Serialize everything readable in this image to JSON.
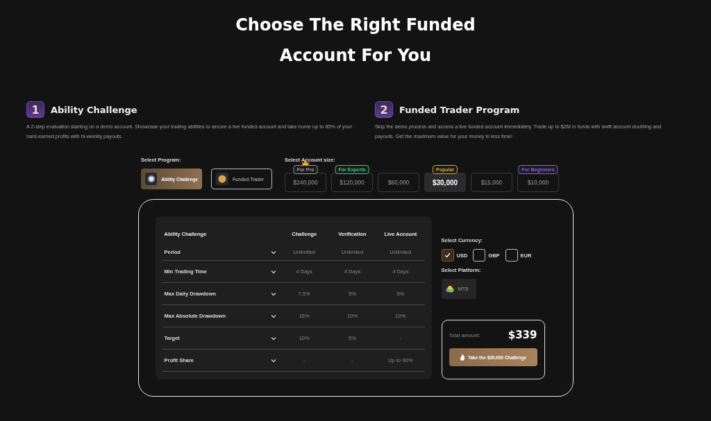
{
  "heading": "Choose The Right Funded Account For You",
  "programs_info": [
    {
      "number": "1",
      "title": "Ability Challenge",
      "description": "A 2-step evaluation starting on a demo account. Showcase your trading abilities to secure a live funded account and take home up to 85% of your hard-earned profits with bi-weekly payouts."
    },
    {
      "number": "2",
      "title": "Funded Trader Program",
      "description": "Skip the demo process and access a live funded account immediately. Trade up to $2M in funds with swift account doubling and payouts. Get the maximum value for your money in less time!"
    }
  ],
  "program_select": {
    "label": "Select Program:",
    "options": [
      {
        "label": "Ability Challenge",
        "selected": true,
        "kind": "target"
      },
      {
        "label": "Funded Trader",
        "selected": false,
        "kind": "coin"
      }
    ]
  },
  "size_select": {
    "label": "Select Account size:",
    "options": [
      {
        "label": "$240,000",
        "selected": false,
        "badge": "For Pro",
        "color": "#9a9a9a",
        "crown": true
      },
      {
        "label": "$120,000",
        "selected": false,
        "badge": "For Experts",
        "color": "#2fcf7a"
      },
      {
        "label": "$60,000",
        "selected": false
      },
      {
        "label": "$30,000",
        "selected": true,
        "badge": "Popular",
        "color": "#d9a62a"
      },
      {
        "label": "$15,000",
        "selected": false
      },
      {
        "label": "$10,000",
        "selected": false,
        "badge": "For Beginners",
        "color": "#8b5cf6"
      }
    ]
  },
  "table": {
    "columns": [
      "Ability Challenge",
      "Challenge",
      "Verification",
      "Live Account"
    ],
    "rows": [
      {
        "label": "Period",
        "expanded": false,
        "values": [
          "Unlimited",
          "Unlimited",
          "Unlimited"
        ]
      },
      {
        "label": "Min Trading Time",
        "expanded": false,
        "values": [
          "4 Days",
          "4 Days",
          "4 Days"
        ]
      },
      {
        "label": "Max Daily Drawdown",
        "expanded": false,
        "values": [
          "7.5%",
          "5%",
          "5%"
        ]
      },
      {
        "label": "Max Absolute Drawdown",
        "expanded": false,
        "values": [
          "15%",
          "10%",
          "10%"
        ]
      },
      {
        "label": "Target",
        "expanded": false,
        "values": [
          "10%",
          "5%",
          "-"
        ]
      },
      {
        "label": "Profit Share",
        "expanded": false,
        "values": [
          "-",
          "-",
          "Up to 90%"
        ]
      }
    ]
  },
  "currency": {
    "label": "Select Currency:",
    "options": [
      {
        "label": "USD",
        "checked": true
      },
      {
        "label": "GBP",
        "checked": false
      },
      {
        "label": "EUR",
        "checked": false
      }
    ]
  },
  "platform": {
    "label": "Select Platform:",
    "options": [
      {
        "label": "MT5",
        "selected": false
      }
    ]
  },
  "total": {
    "label": "Total amount:",
    "amount": "$339",
    "button": "Take the $30,000 Challenge"
  }
}
